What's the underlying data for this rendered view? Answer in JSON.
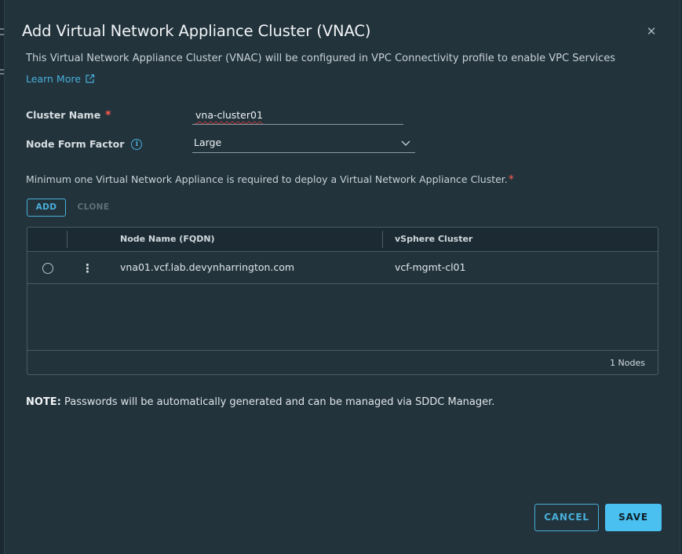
{
  "dialog": {
    "title": "Add Virtual Network Appliance Cluster (VNAC)",
    "description": "This Virtual Network Appliance Cluster (VNAC) will be configured in VPC Connectivity profile to enable VPC Services",
    "learn_more": "Learn More"
  },
  "form": {
    "cluster_name_label": "Cluster Name",
    "required_mark": "*",
    "cluster_name_value": "vna-cluster01",
    "form_factor_label": "Node Form Factor",
    "form_factor_value": "Large",
    "info_glyph": "i",
    "min_note": "Minimum one Virtual Network Appliance is required to deploy a Virtual Network Appliance Cluster."
  },
  "actions": {
    "add": "ADD",
    "clone": "CLONE"
  },
  "table": {
    "columns": [
      "Node Name (FQDN)",
      "vSphere Cluster"
    ],
    "rows": [
      {
        "node_name": "vna01.vcf.lab.devynharrington.com",
        "vsphere_cluster": "vcf-mgmt-cl01"
      }
    ],
    "footer": "1 Nodes"
  },
  "note": {
    "prefix": "NOTE:",
    "text": " Passwords will be automatically generated and can be managed via SDDC Manager."
  },
  "footer": {
    "cancel": "CANCEL",
    "save": "SAVE"
  },
  "icons": {
    "close": "close-icon",
    "external_link": "external-link-icon",
    "info": "info-icon",
    "chevron": "chevron-down-icon",
    "kebab": "kebab-menu-icon"
  },
  "colors": {
    "accent": "#49afd9",
    "primary_button": "#49c0f0",
    "required": "#ff5a4e",
    "background": "#22333c"
  }
}
